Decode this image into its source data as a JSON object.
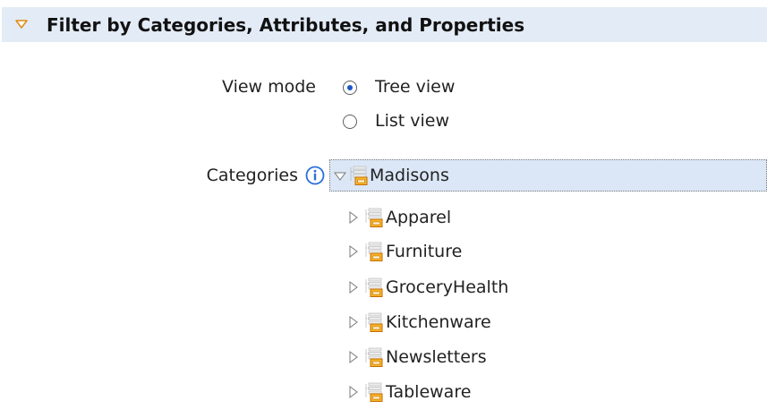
{
  "section": {
    "title": "Filter by Categories, Attributes, and Properties"
  },
  "view_mode": {
    "label": "View mode",
    "options": [
      {
        "label": "Tree view",
        "selected": true
      },
      {
        "label": "List view",
        "selected": false
      }
    ]
  },
  "categories": {
    "label": "Categories",
    "root": {
      "label": "Madisons",
      "expanded": true,
      "children": [
        {
          "label": "Apparel",
          "expanded": false
        },
        {
          "label": "Furniture",
          "expanded": false
        },
        {
          "label": "GroceryHealth",
          "expanded": false
        },
        {
          "label": "Kitchenware",
          "expanded": false
        },
        {
          "label": "Newsletters",
          "expanded": false
        },
        {
          "label": "Tableware",
          "expanded": false
        }
      ]
    }
  },
  "colors": {
    "header_bg": "#e3ebf6",
    "selected_row_bg": "#dbe7f7",
    "accent_orange": "#f0a020",
    "radio_dot": "#1c56c9",
    "info_blue": "#2b6fd6"
  },
  "icons": {
    "section_toggle": "chevron-down-icon",
    "info": "info-icon",
    "category": "catalog-category-icon",
    "tree_collapsed": "triangle-right-icon",
    "tree_expanded": "triangle-down-icon"
  }
}
